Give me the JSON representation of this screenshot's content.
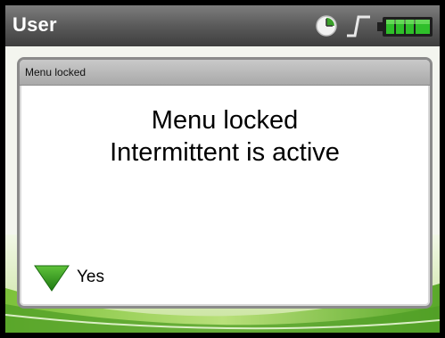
{
  "window": {
    "title": "User"
  },
  "status_icons": [
    "clock-icon",
    "signal-step-icon",
    "battery-icon"
  ],
  "dialog": {
    "header_title": "Menu locked",
    "message_line1": "Menu locked",
    "message_line2": "Intermittent is active",
    "yes_label": "Yes"
  },
  "colors": {
    "accent_green": "#3a9a1e",
    "titlebar": "#5a5a5a",
    "battery_green": "#2fbf2a"
  }
}
